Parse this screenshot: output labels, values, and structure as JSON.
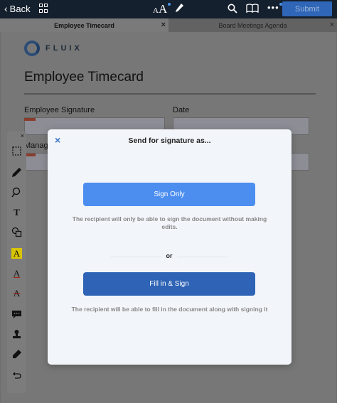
{
  "toolbar": {
    "back_label": "Back",
    "submit_label": "Submit",
    "font_size_small": "A",
    "font_size_large": "A",
    "more_label": "•••",
    "back_chevron": "‹"
  },
  "tabs": [
    {
      "label": "Employee Timecard",
      "close": "×",
      "active": true
    },
    {
      "label": "Board Meetings Agenda",
      "close": "×",
      "active": false
    }
  ],
  "document": {
    "logo_text": "FLUIX",
    "title": "Employee Timecard",
    "fields": {
      "employee_signature_label": "Employee Signature",
      "date_label": "Date",
      "manager_label_partial": "Manag"
    }
  },
  "tools": {
    "close": "×",
    "text_tool": "T",
    "highlight_tool": "A",
    "underline_tool": "A",
    "strikethrough_tool": "A"
  },
  "modal": {
    "close": "×",
    "title": "Send for signature as...",
    "sign_only_label": "Sign Only",
    "sign_only_desc": "The recipient will only be able to sign the document without making edits.",
    "or_label": "or",
    "fill_sign_label": "Fill in & Sign",
    "fill_sign_desc": "The recipient will be able to fill in the document along with signing it"
  },
  "colors": {
    "toolbar_bg": "#15202e",
    "submit_bg": "#2f66b8",
    "sign_only_bg": "#4c8ef0",
    "fill_sign_bg": "#2e63b5",
    "accent": "#3a73c7"
  },
  "icons": [
    "grid-icon",
    "font-size-icon",
    "pen-icon",
    "search-icon",
    "book-icon",
    "more-icon",
    "select-icon",
    "pencil-icon",
    "lasso-icon",
    "shapes-icon",
    "note-icon",
    "stamp-icon",
    "marker-icon",
    "undo-icon"
  ]
}
